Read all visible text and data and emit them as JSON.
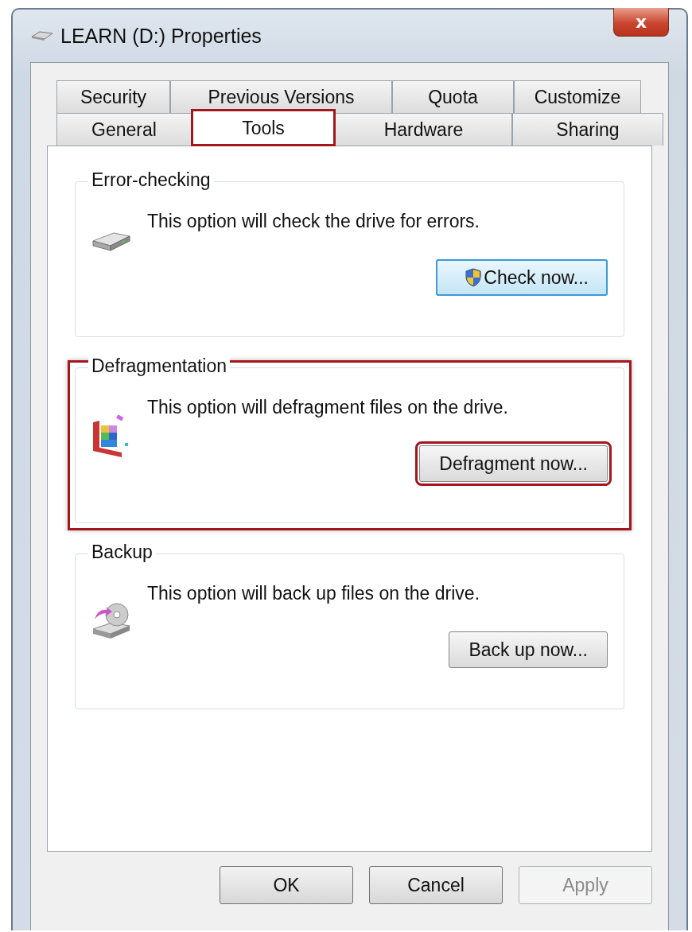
{
  "window": {
    "title": "LEARN (D:) Properties",
    "close": "x"
  },
  "tab_rows": [
    [
      {
        "label": "Security",
        "selected": false,
        "highlighted": false
      },
      {
        "label": "Previous Versions",
        "selected": false,
        "highlighted": false
      },
      {
        "label": "Quota",
        "selected": false,
        "highlighted": false
      },
      {
        "label": "Customize",
        "selected": false,
        "highlighted": false
      }
    ],
    [
      {
        "label": "General",
        "selected": false,
        "highlighted": false
      },
      {
        "label": "Tools",
        "selected": true,
        "highlighted": true
      },
      {
        "label": "Hardware",
        "selected": false,
        "highlighted": false
      },
      {
        "label": "Sharing",
        "selected": false,
        "highlighted": false
      }
    ]
  ],
  "groups": [
    {
      "kind": "check",
      "title": "Error-checking",
      "text": "This option will check the drive for errors.",
      "button": "Check now...",
      "button_focused": true,
      "button_shield": true,
      "highlighted": false,
      "button_highlighted": false
    },
    {
      "kind": "defrag",
      "title": "Defragmentation",
      "text": "This option will defragment files on the drive.",
      "button": "Defragment now...",
      "button_focused": false,
      "button_shield": false,
      "highlighted": true,
      "button_highlighted": true
    },
    {
      "kind": "backup",
      "title": "Backup",
      "text": "This option will back up files on the drive.",
      "button": "Back up now...",
      "button_focused": false,
      "button_shield": false,
      "highlighted": false,
      "button_highlighted": false
    }
  ],
  "buttons": [
    {
      "label": "OK",
      "disabled": false
    },
    {
      "label": "Cancel",
      "disabled": false
    },
    {
      "label": "Apply",
      "disabled": true
    }
  ]
}
